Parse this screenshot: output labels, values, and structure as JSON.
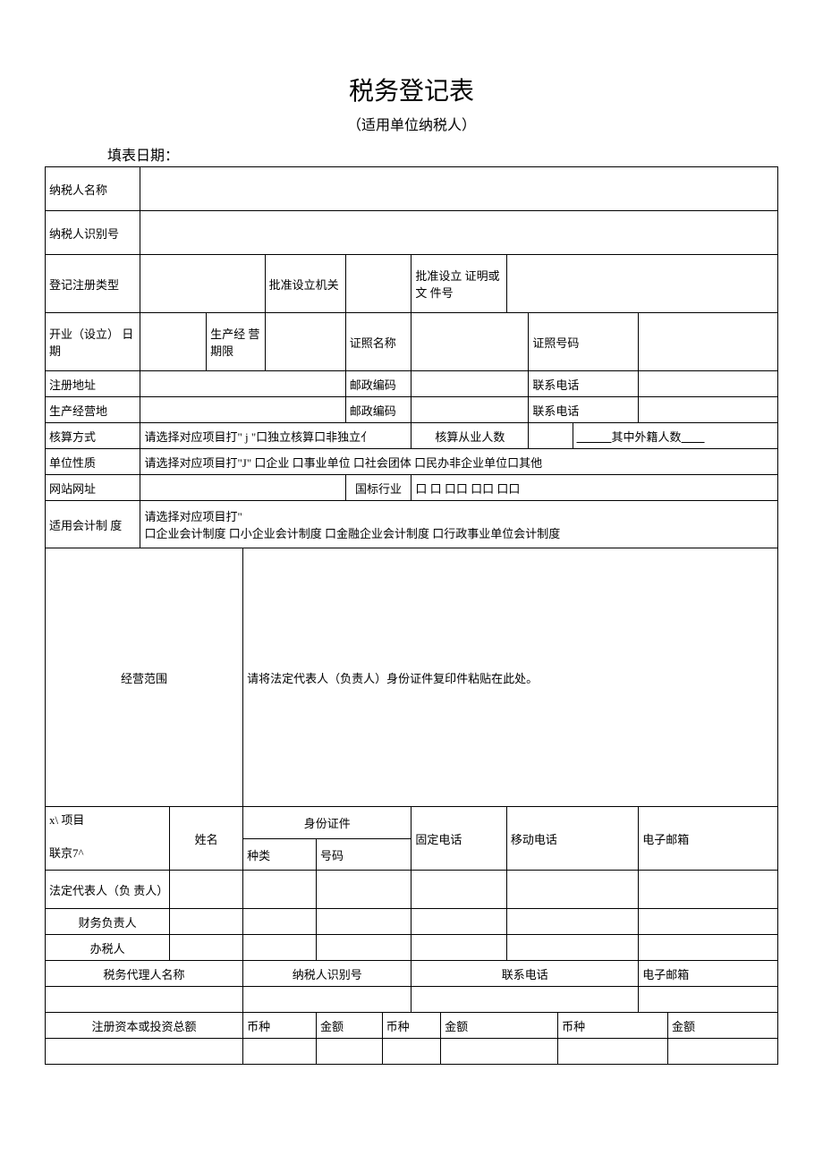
{
  "title": "税务登记表",
  "subtitle": "（适用单位纳税人）",
  "fill_date_label": "填表日期：",
  "labels": {
    "taxpayer_name": "纳税人名称",
    "taxpayer_id": "纳税人识别号",
    "reg_type": "登记注册类型",
    "approval_org": "批准设立机关",
    "approval_doc": "批准设立 证明或文 件号",
    "open_date": "开业（设立） 日期",
    "biz_term": "生产经 营期限",
    "cert_name": "证照名称",
    "cert_no": "证照号码",
    "reg_addr": "注册地址",
    "postal": "邮政编码",
    "phone": "联系电话",
    "biz_place": "生产经营地",
    "accounting_method": "核算方式",
    "accounting_method_opt": "请选择对应项目打\" j \"口独立核算口非独立亻",
    "staff_count": "核算从业人数",
    "foreign_staff": "其中外籍人数",
    "unit_nature": "单位性质",
    "unit_nature_opt": "请选择对应项目打\"J\" 口企业 口事业单位 口社会团体 口民办非企业单位口其他",
    "website": "网站网址",
    "industry": "国标行业",
    "industry_boxes": "口 口 口口 口口 口口",
    "accounting_system": "适用会计制 度",
    "accounting_system_opt": "请选择对应项目打\"\n口企业会计制度 口小企业会计制度 口金融企业会计制度 口行政事业单位会计制度",
    "biz_scope": "经营范围",
    "biz_scope_note": "请将法定代表人（负责人）身份证件复印件粘贴在此处。",
    "project": "x\\ 项目",
    "lianjing": "联京7^",
    "name": "姓名",
    "id_cert": "身份证件",
    "fixed_phone": "固定电话",
    "mobile": "移动电话",
    "email": "电子邮箱",
    "id_type": "种类",
    "id_no": "号码",
    "legal_rep": "法定代表人（负 责人）",
    "cfo": "财务负责人",
    "tax_handler": "办税人",
    "tax_agent_name": "税务代理人名称",
    "capital": "注册资本或投资总额",
    "currency": "币种",
    "amount": "金额"
  }
}
